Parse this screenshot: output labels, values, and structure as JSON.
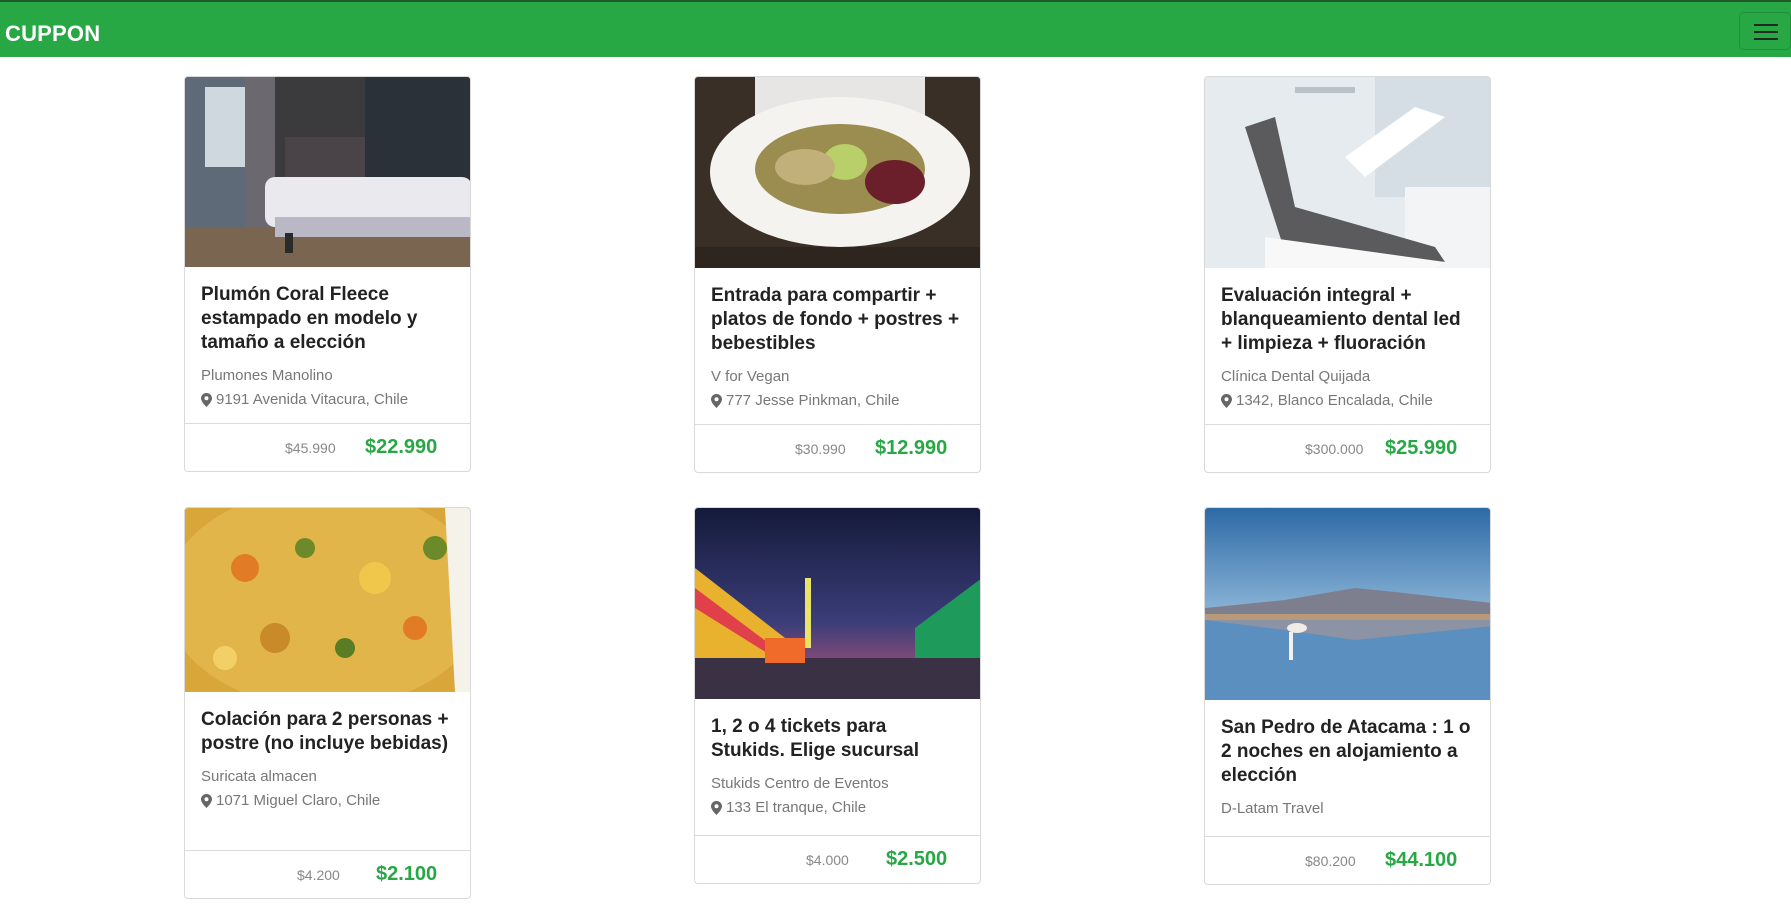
{
  "navbar": {
    "brand": "CUPPON"
  },
  "deals": [
    {
      "title": "Plumón Coral Fleece estampado en modelo y tamaño a elección",
      "merchant": "Plumones Manolino",
      "address": "9191 Avenida Vitacura, Chile",
      "old_price": "$45.990",
      "new_price": "$22.990"
    },
    {
      "title": "Entrada para compartir + platos de fondo + postres + bebestibles",
      "merchant": "V for Vegan",
      "address": "777 Jesse Pinkman, Chile",
      "old_price": "$30.990",
      "new_price": "$12.990"
    },
    {
      "title": "Evaluación integral + blanqueamiento dental led + limpieza + fluoración",
      "merchant": "Clínica Dental Quijada",
      "address": "1342, Blanco Encalada, Chile",
      "old_price": "$300.000",
      "new_price": "$25.990"
    },
    {
      "title": "Colación para 2 personas + postre (no incluye bebidas)",
      "merchant": "Suricata almacen",
      "address": "1071 Miguel Claro, Chile",
      "old_price": "$4.200",
      "new_price": "$2.100"
    },
    {
      "title": "1, 2 o 4 tickets para Stukids. Elige sucursal",
      "merchant": "Stukids Centro de Eventos",
      "address": "133 El tranque, Chile",
      "old_price": "$4.000",
      "new_price": "$2.500"
    },
    {
      "title": "San Pedro de Atacama : 1 o 2 noches en alojamiento a elección",
      "merchant": "D-Latam Travel",
      "old_price": "$80.200",
      "new_price": "$44.100"
    }
  ],
  "colors": {
    "brand_green": "#28a745",
    "price_green": "#28a745"
  },
  "icons": {
    "address": "map-pin-icon",
    "menu": "hamburger-icon"
  }
}
